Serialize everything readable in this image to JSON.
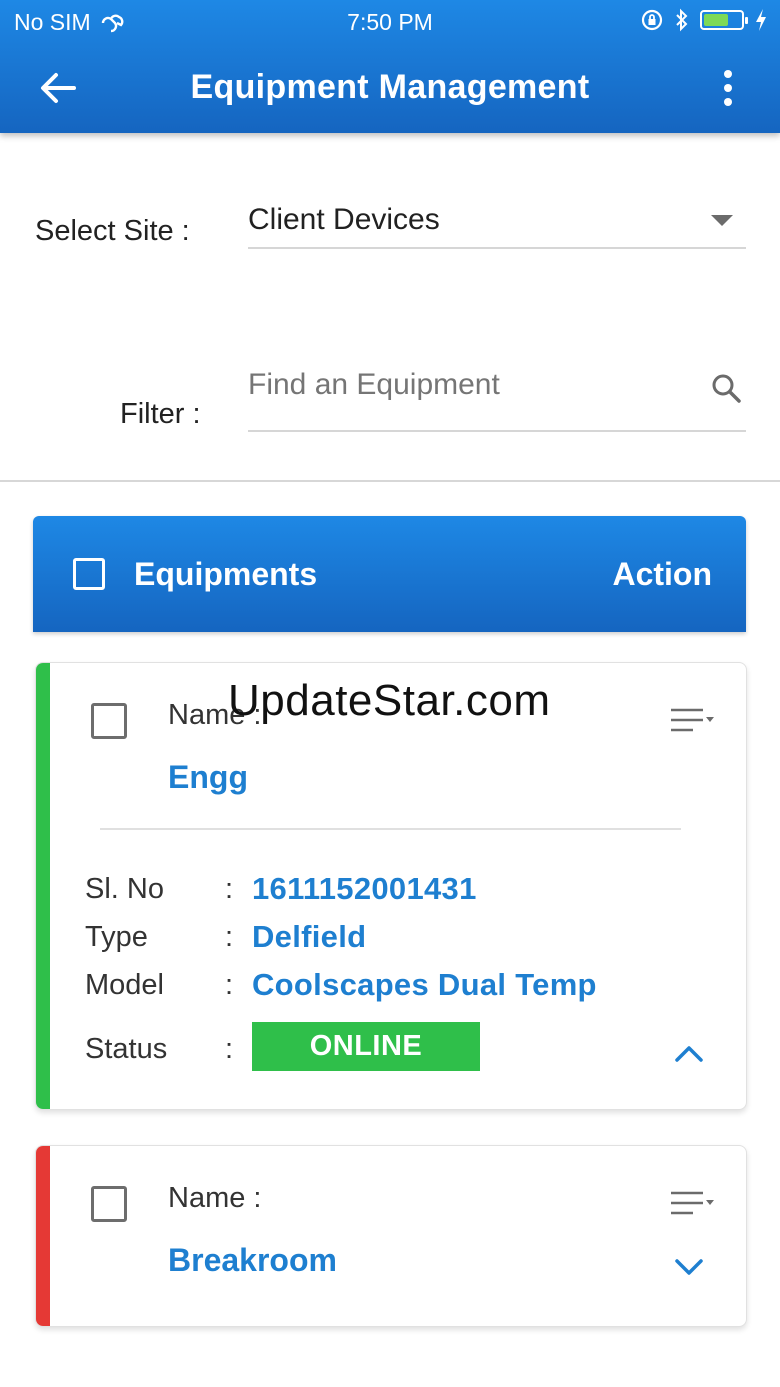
{
  "status_bar": {
    "carrier": "No SIM",
    "time": "7:50 PM",
    "colors": {
      "battery_fill": "#7ed957"
    }
  },
  "app_bar": {
    "title": "Equipment Management",
    "back_icon": "arrow-left-icon",
    "menu_icon": "more-vertical-icon"
  },
  "site_select": {
    "label": "Select Site :",
    "value": "Client Devices",
    "icon": "caret-down-icon"
  },
  "filter": {
    "label": "Filter :",
    "placeholder": "Find an Equipment",
    "icon": "search-icon"
  },
  "table_header": {
    "equipments_label": "Equipments",
    "action_label": "Action"
  },
  "cards": [
    {
      "name_label": "Name :",
      "name_value": "Engg",
      "accent_color": "#2fbf4a",
      "details": [
        {
          "label": "Sl. No",
          "colon": ":",
          "value": "1611152001431"
        },
        {
          "label": "Type",
          "colon": ":",
          "value": "Delfield"
        },
        {
          "label": "Model",
          "colon": ":",
          "value": "Coolscapes Dual Temp"
        }
      ],
      "status_label": "Status",
      "status_colon": ":",
      "status_value": "ONLINE",
      "status_color": "#2fbf4a",
      "expanded": true
    },
    {
      "name_label": "Name :",
      "name_value": "Breakroom",
      "accent_color": "#e53935",
      "expanded": false
    }
  ],
  "watermark": "UpdateStar.com",
  "colors": {
    "primary": "#1e88e5",
    "primary_dark": "#1565c0",
    "link_blue": "#1e7fd0",
    "online_green": "#2fbf4a",
    "offline_red": "#e53935"
  }
}
